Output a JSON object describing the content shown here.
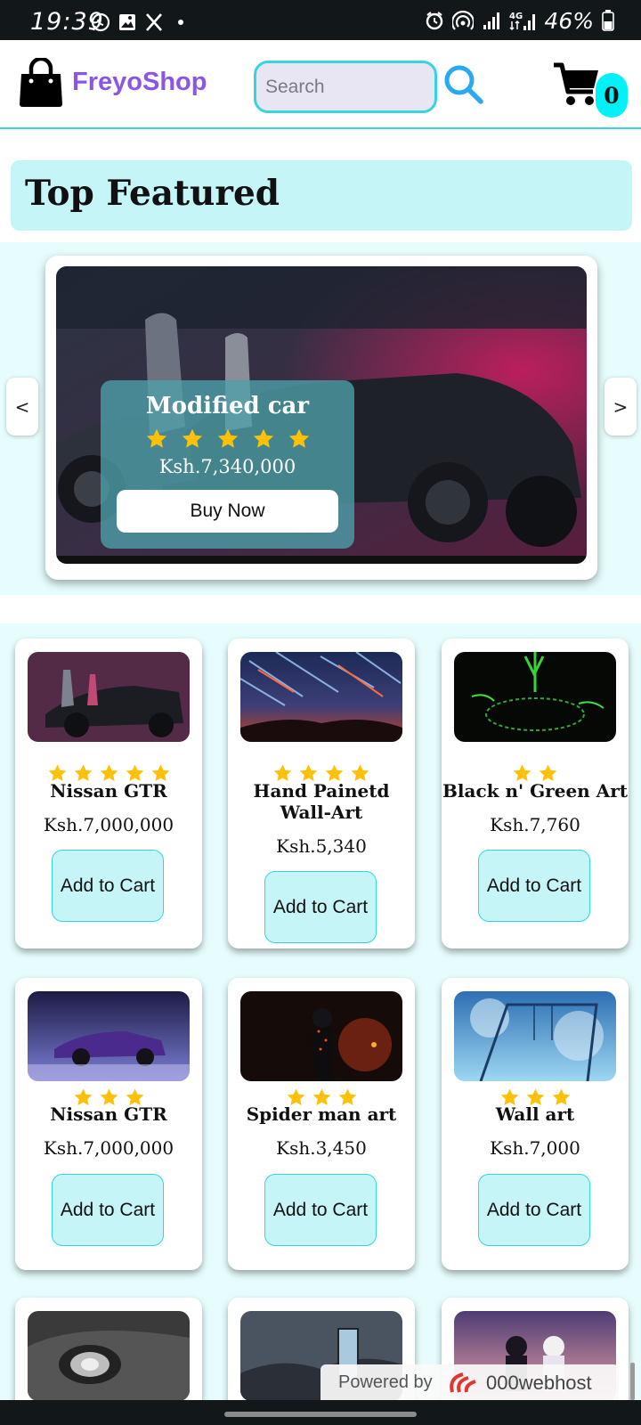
{
  "status_bar": {
    "time": "19:39",
    "battery": "46%",
    "left_icons": [
      "whatsapp-icon",
      "gallery-icon",
      "x-icon",
      "dot-icon"
    ],
    "right_icons": [
      "alarm-icon",
      "hotspot-icon",
      "signal-icon",
      "4g-signal-icon",
      "battery-icon"
    ]
  },
  "header": {
    "brand": "FreyoShop",
    "search_placeholder": "Search",
    "cart_count": "0"
  },
  "featured": {
    "title": "Top Featured",
    "slide": {
      "name": "Modified car",
      "rating": 5,
      "price": "Ksh.7,340,000",
      "button": "Buy Now"
    },
    "prev_label": "<",
    "next_label": ">"
  },
  "products": [
    {
      "name": "Nissan GTR",
      "rating": 5,
      "price": "Ksh.7,000,000",
      "button": "Add to Cart"
    },
    {
      "name": "Hand Painetd Wall-Art",
      "rating": 4,
      "price": "Ksh.5,340",
      "button": "Add to Cart"
    },
    {
      "name": "Black n' Green Art",
      "rating": 2,
      "price": "Ksh.7,760",
      "button": "Add to Cart"
    },
    {
      "name": "Nissan GTR",
      "rating": 3,
      "price": "Ksh.7,000,000",
      "button": "Add to Cart"
    },
    {
      "name": "Spider man art",
      "rating": 3,
      "price": "Ksh.3,450",
      "button": "Add to Cart"
    },
    {
      "name": "Wall art",
      "rating": 3,
      "price": "Ksh.7,000",
      "button": "Add to Cart"
    }
  ],
  "powered_by": {
    "text": "Powered by",
    "brand": "000webhost"
  },
  "colors": {
    "accent": "#37d4dd",
    "brand": "#8a56e8",
    "light_cyan": "#c6f5f7",
    "band": "#e7fdfd",
    "star": "#ffc107"
  }
}
